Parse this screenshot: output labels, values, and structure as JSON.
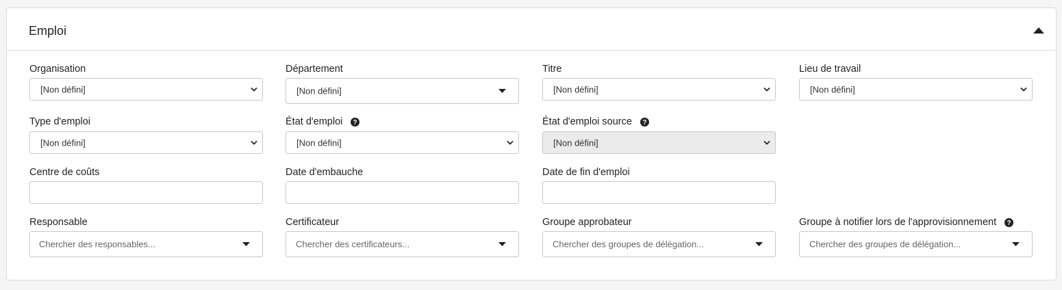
{
  "panel": {
    "title": "Emploi",
    "collapse_icon": "caret-up-icon"
  },
  "fields": {
    "organisation": {
      "label": "Organisation",
      "value": "[Non défini]"
    },
    "departement": {
      "label": "Département",
      "value": "[Non défini]"
    },
    "titre": {
      "label": "Titre",
      "value": "[Non défini]"
    },
    "lieu_travail": {
      "label": "Lieu de travail",
      "value": "[Non défini]"
    },
    "type_emploi": {
      "label": "Type d'emploi",
      "value": "[Non défini]"
    },
    "etat_emploi": {
      "label": "État d'emploi",
      "value": "[Non défini]"
    },
    "etat_emploi_source": {
      "label": "État d'emploi source",
      "value": "[Non défini]"
    },
    "centre_couts": {
      "label": "Centre de coûts",
      "value": ""
    },
    "date_embauche": {
      "label": "Date d'embauche",
      "value": ""
    },
    "date_fin_emploi": {
      "label": "Date de fin d'emploi",
      "value": ""
    },
    "responsable": {
      "label": "Responsable",
      "placeholder": "Chercher des responsables..."
    },
    "certificateur": {
      "label": "Certificateur",
      "placeholder": "Chercher des certificateurs..."
    },
    "groupe_approbateur": {
      "label": "Groupe approbateur",
      "placeholder": "Chercher des groupes de délégation..."
    },
    "groupe_notifier": {
      "label": "Groupe à notifier lors de l'approvisionnement",
      "placeholder": "Chercher des groupes de délégation..."
    }
  },
  "colors": {
    "border": "#c8c8c8",
    "disabled_bg": "#ebebeb",
    "page_bg": "#f5f5f5"
  }
}
